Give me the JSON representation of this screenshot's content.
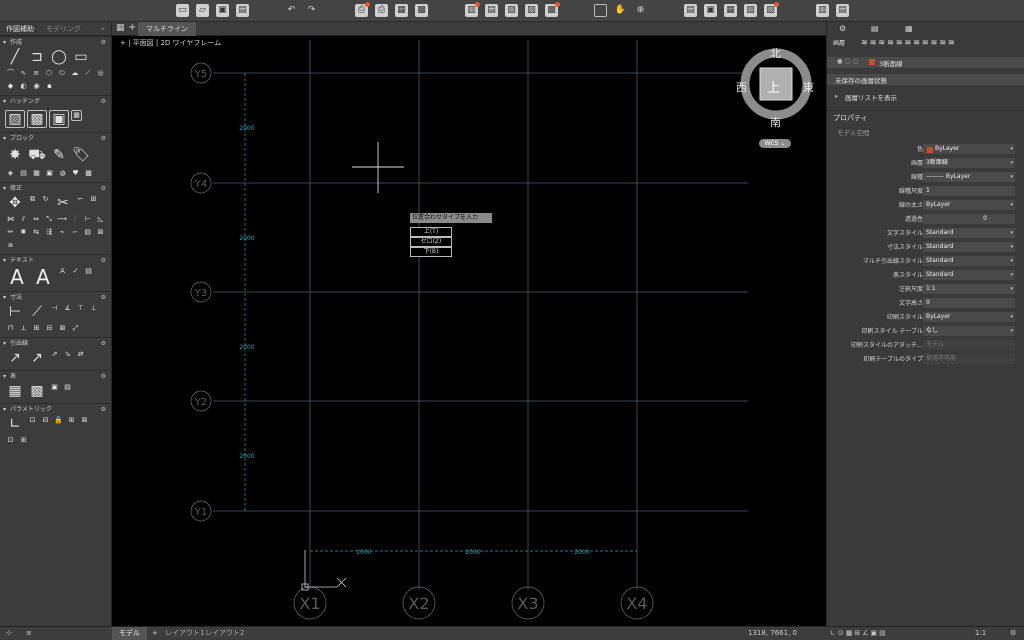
{
  "left_palette": {
    "tabs": [
      "作図補助",
      "モデリング"
    ],
    "expand": "»",
    "sections": [
      "作成",
      "ハッチング",
      "ブロック",
      "修正",
      "テキスト",
      "寸法",
      "引出線",
      "表",
      "パラメトリック"
    ]
  },
  "canvas": {
    "tab_label": "マルチライン",
    "view_label": "+ | 平面図 | 2D ワイヤフレーム",
    "popup": {
      "title": "位置合わせタイプを入力",
      "items": [
        "上(T)",
        "ゼロ(Z)",
        "下(B)"
      ]
    },
    "grid_labels_y": [
      "Y5",
      "Y4",
      "Y3",
      "Y2",
      "Y1"
    ],
    "grid_labels_x": [
      "X1",
      "X2",
      "X3",
      "X4"
    ],
    "dims": [
      "2000",
      "2000",
      "2000",
      "2000",
      "2000",
      "2000",
      "2000"
    ],
    "compass": {
      "north": "北",
      "south": "南",
      "east": "東",
      "west": "西",
      "top": "上",
      "wcs": "WCS"
    }
  },
  "right_panel": {
    "layer_header": "画層",
    "layer_name": "3断面線",
    "layer_state": "未保存の画層状態",
    "layer_list": "画層リストを表示",
    "properties_header": "プロパティ",
    "model_space": "モデル空間",
    "properties": [
      {
        "label": "色",
        "value": "ByLayer"
      },
      {
        "label": "画層",
        "value": "3断面線"
      },
      {
        "label": "線種",
        "value": "———  ByLayer"
      },
      {
        "label": "線種尺度",
        "value": "1"
      },
      {
        "label": "線の太さ",
        "value": "ByLayer"
      },
      {
        "label": "透過性",
        "value": "0"
      },
      {
        "label": "文字スタイル",
        "value": "Standard"
      },
      {
        "label": "寸法スタイル",
        "value": "Standard"
      },
      {
        "label": "マルチ引出線スタイル",
        "value": "Standard"
      },
      {
        "label": "表スタイル",
        "value": "Standard"
      },
      {
        "label": "注釈尺度",
        "value": "1:1"
      },
      {
        "label": "文字高さ",
        "value": "0"
      },
      {
        "label": "印刷スタイル",
        "value": "ByLayer"
      },
      {
        "label": "印刷スタイル テーブル",
        "value": "なし"
      },
      {
        "label": "印刷スタイルのアタッチ…",
        "value": "モデル"
      },
      {
        "label": "印刷テーブルのタイプ",
        "value": "使用不可能"
      }
    ]
  },
  "status_bar": {
    "tabs": [
      "モデル",
      "レイアウト1",
      "レイアウト2"
    ],
    "coords": "1318, 7661, 0",
    "scale": "1:1"
  },
  "colors": {
    "grid": "#5a6a78",
    "dim": "#2aa0b0",
    "canvas": "#000000",
    "layer_swatch": "#d9452b"
  }
}
